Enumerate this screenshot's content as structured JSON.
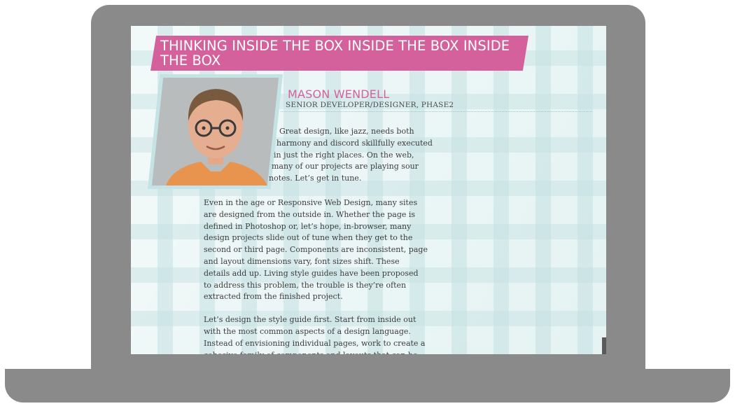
{
  "article": {
    "title": "THINKING INSIDE THE BOX INSIDE THE BOX INSIDE THE BOX",
    "author_name": "MASON WENDELL",
    "author_title": "SENIOR DEVELOPER/DESIGNER, PHASE2",
    "intro_lines": [
      "Great design, like jazz, needs both",
      "harmony and discord skillfully executed",
      "in just the right places. On the web,",
      "many of our projects are playing sour",
      "notes. Let’s get in tune."
    ],
    "paragraph_1": "Even in the age or Responsive Web Design, many sites are designed from the outside in. Whether the page is defined in Photoshop or, let’s hope, in-browser, many design projects slide out of tune when they get to the second or third page. Components are inconsistent, page and layout dimensions vary, font sizes shift. These details add up. Living style guides have been proposed to address this problem, the trouble is they’re often extracted from the finished project.",
    "paragraph_2": "Let’s design the style guide first. Start from inside out with the most common aspects of a design language. Instead of envisioning individual pages, work to create a cohesive family of components and layouts that can be assembled into any page. Rather than pick out what's already part of the"
  },
  "icons": {
    "author_photo": "author-photo"
  },
  "colors": {
    "accent": "#d4619b",
    "frame": "#c5e2e4",
    "device": "#8a8a8a",
    "background": "#ecf6f6"
  }
}
